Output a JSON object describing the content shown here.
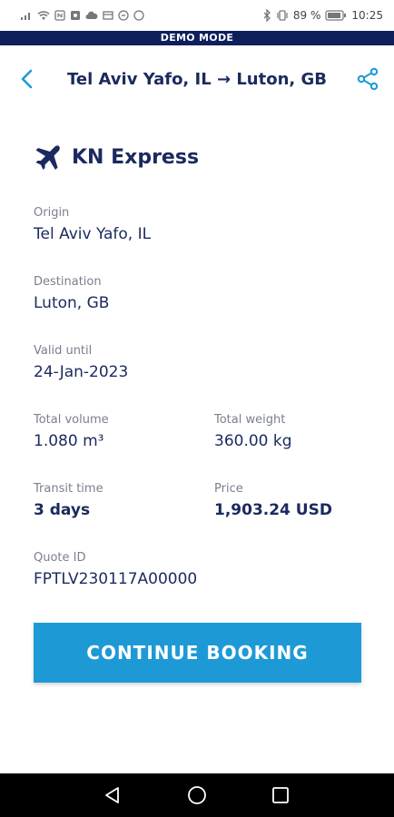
{
  "status_bar": {
    "battery_percent": "89 %",
    "time": "10:25",
    "icons": [
      "signal-icon",
      "wifi-icon",
      "nfc-icon",
      "sim-icon",
      "cloud-icon",
      "data-icon",
      "mute-icon",
      "circle-icon",
      "bluetooth-icon",
      "vibrate-icon",
      "battery-icon"
    ]
  },
  "demo_banner": "DEMO MODE",
  "header": {
    "title": "Tel Aviv Yafo, IL → Luton, GB",
    "back_icon": "chevron-left-icon",
    "share_icon": "share-icon"
  },
  "service": {
    "icon": "airplane-icon",
    "name": "KN Express"
  },
  "fields": {
    "origin": {
      "label": "Origin",
      "value": "Tel Aviv Yafo, IL"
    },
    "destination": {
      "label": "Destination",
      "value": "Luton, GB"
    },
    "valid_until": {
      "label": "Valid until",
      "value": "24-Jan-2023"
    },
    "total_volume": {
      "label": "Total volume",
      "value": "1.080 m³"
    },
    "total_weight": {
      "label": "Total weight",
      "value": "360.00 kg"
    },
    "transit_time": {
      "label": "Transit time",
      "value": "3 days"
    },
    "price": {
      "label": "Price",
      "value": "1,903.24 USD"
    },
    "quote_id": {
      "label": "Quote ID",
      "value": "FPTLV230117A00000"
    }
  },
  "continue_button": "CONTINUE BOOKING",
  "colors": {
    "primary": "#1d9ad6",
    "navy": "#1b2a5e",
    "banner": "#0f1f5c",
    "label_gray": "#7a7f8c"
  }
}
